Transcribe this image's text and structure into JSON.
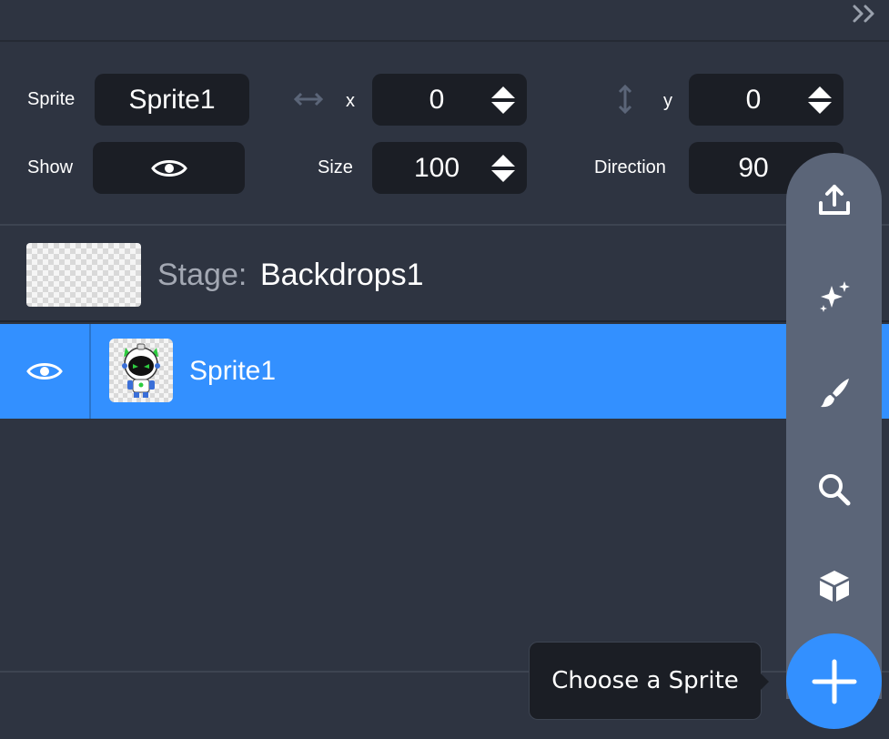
{
  "sprite_info": {
    "sprite_label": "Sprite",
    "sprite_name": "Sprite1",
    "x_label": "x",
    "x_value": "0",
    "y_label": "y",
    "y_value": "0",
    "show_label": "Show",
    "size_label": "Size",
    "size_value": "100",
    "direction_label": "Direction",
    "direction_value": "90"
  },
  "stage": {
    "label": "Stage:",
    "backdrop_name": "Backdrops1"
  },
  "sprites": [
    {
      "name": "Sprite1",
      "visible": true,
      "selected": true
    }
  ],
  "sprite_menu": {
    "items": [
      "upload-icon",
      "sparkle-icon",
      "paint-brush-icon",
      "search-icon",
      "cube-icon"
    ],
    "tooltip": "Choose a Sprite"
  },
  "colors": {
    "accent": "#3390ff",
    "panel": "#2e3441",
    "field": "#1b1e25",
    "menu": "#5b6578"
  }
}
